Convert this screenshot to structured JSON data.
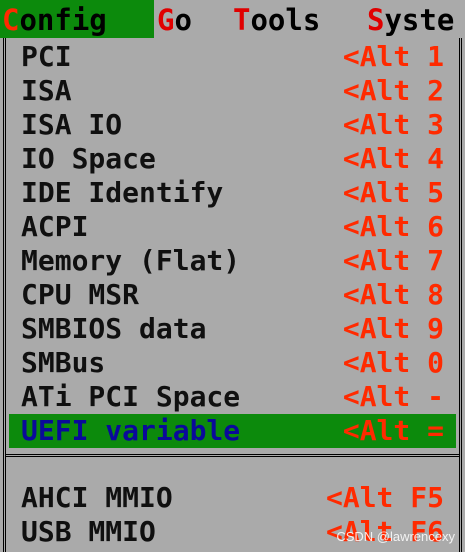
{
  "menubar": {
    "items": [
      {
        "hot": "C",
        "rest": "onfig"
      },
      {
        "hot": "G",
        "rest": "o"
      },
      {
        "hot": "T",
        "rest": "ools"
      },
      {
        "hot": "S",
        "rest": "yste"
      }
    ],
    "active_index": 0
  },
  "dropdown": {
    "items": [
      {
        "label": "PCI",
        "shortcut": "<Alt 1"
      },
      {
        "label": "ISA",
        "shortcut": "<Alt 2"
      },
      {
        "label": "ISA IO",
        "shortcut": "<Alt 3"
      },
      {
        "label": "IO Space",
        "shortcut": "<Alt 4"
      },
      {
        "label": "IDE Identify",
        "shortcut": "<Alt 5"
      },
      {
        "label": "ACPI",
        "shortcut": "<Alt 6"
      },
      {
        "label": "Memory (Flat)",
        "shortcut": "<Alt 7"
      },
      {
        "label": "CPU MSR",
        "shortcut": "<Alt 8"
      },
      {
        "label": "SMBIOS data",
        "shortcut": "<Alt 9"
      },
      {
        "label": "SMBus",
        "shortcut": "<Alt 0"
      },
      {
        "label": "ATi PCI Space",
        "shortcut": "<Alt -"
      },
      {
        "label": "UEFI variable",
        "shortcut": "<Alt ="
      }
    ],
    "selected_index": 11,
    "items_after_separator": [
      {
        "label": "AHCI MMIO",
        "shortcut": "<Alt F5"
      },
      {
        "label": "USB MMIO",
        "shortcut": "<Alt F6"
      }
    ]
  },
  "watermark": "CSDN @lawrencexy",
  "colors": {
    "background": "#aaaaaa",
    "highlight": "#0c8a0c",
    "hotkey": "#ff2a00",
    "selected_text": "#0a0a9a"
  }
}
